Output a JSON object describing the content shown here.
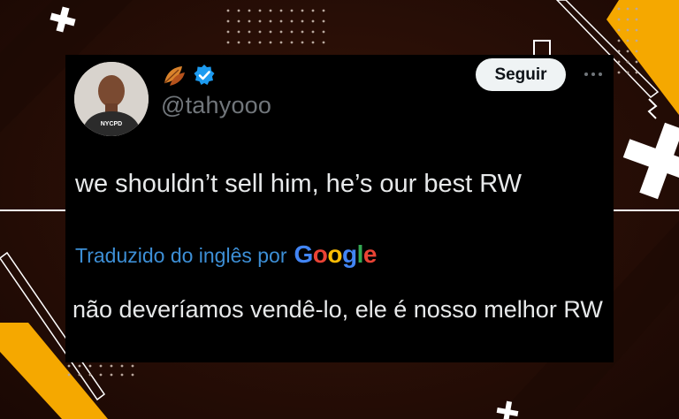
{
  "tweet": {
    "display_name_icon": "leaf-emoji-icon",
    "verified_icon": "verified-badge-icon",
    "handle": "@tahyooo",
    "follow_label": "Seguir",
    "more_icon": "more-icon",
    "text": "we shouldn’t sell him, he’s our best RW",
    "translation": {
      "label": "Traduzido do inglês por",
      "provider": "Google",
      "text": "não deveríamos vendê-lo, ele é nosso melhor RW"
    },
    "avatar_shirt_text": "NYCPD"
  },
  "colors": {
    "background": "#2a0f06",
    "card": "#000000",
    "text": "#e7e9ea",
    "muted": "#71767b",
    "verified": "#1d9bf0",
    "translation_link": "#3d8fd6",
    "accent_yellow": "#f5a800",
    "google_blue": "#4285f4",
    "google_red": "#ea4335",
    "google_yellow": "#fbbc05",
    "google_green": "#34a853"
  }
}
